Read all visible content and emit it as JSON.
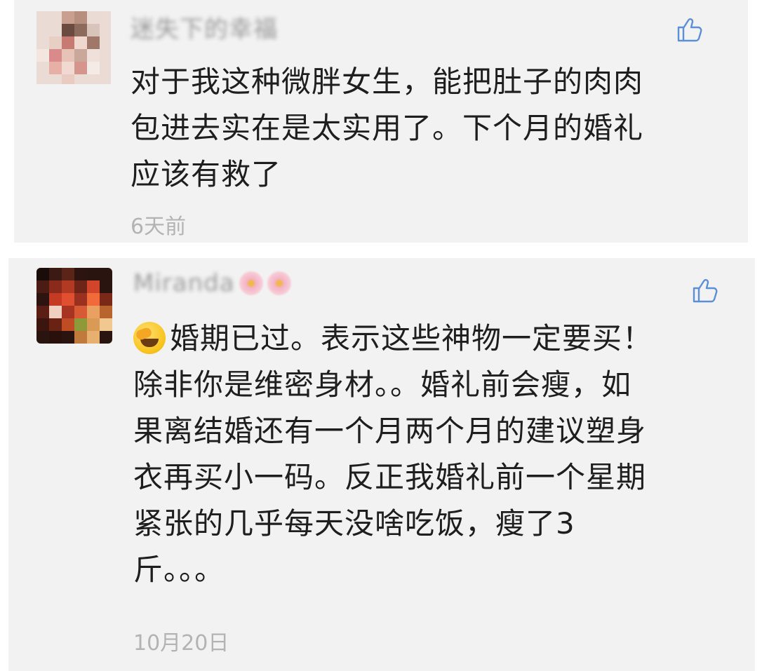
{
  "comments": [
    {
      "username": "迷失下的幸福",
      "content": "对于我这种微胖女生，能把肚子的肉肉\n包进去实在是太实用了。下个月的婚礼\n应该有救了",
      "time": "6天前",
      "icons": {
        "avatar": "avatar-image",
        "like": "thumbs-up-icon"
      }
    },
    {
      "username": "Miranda",
      "content": "婚期已过。表示这些神物一定要买！\n除非你是维密身材。。婚礼前会瘦，如\n果离结婚还有一个月两个月的建议塑身\n衣再买小一码。反正我婚礼前一个星期\n紧张的几乎每天没啥吃饭，瘦了3\n斤。。。",
      "time": "10月20日",
      "icons": {
        "avatar": "avatar-image",
        "like": "thumbs-up-icon",
        "emoji": "facepalm-crying-emoji",
        "name_decoration": "flower-icon"
      }
    }
  ],
  "colors": {
    "card_bg": "#f2f2f2",
    "text": "#1e1e1e",
    "meta": "#b3b3b3",
    "accent": "#5b8fd6"
  }
}
